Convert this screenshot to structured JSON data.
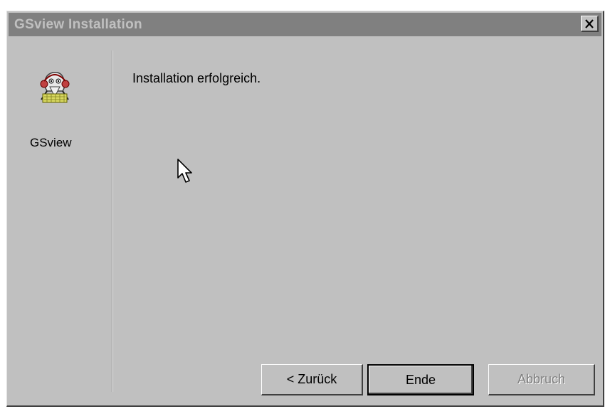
{
  "window": {
    "title": "GSview Installation"
  },
  "sidebar": {
    "app_label": "GSview",
    "icon": "gsview-app-icon"
  },
  "main": {
    "message": "Installation erfolgreich."
  },
  "buttons": {
    "back_label": "< Zurück",
    "finish_label": "Ende",
    "cancel_label": "Abbruch"
  },
  "icons": {
    "close": "close-icon",
    "cursor": "mouse-cursor-icon"
  },
  "colors": {
    "dialog_bg": "#c0c0c0",
    "titlebar_inactive": "#808080",
    "disabled_text": "#808080"
  }
}
